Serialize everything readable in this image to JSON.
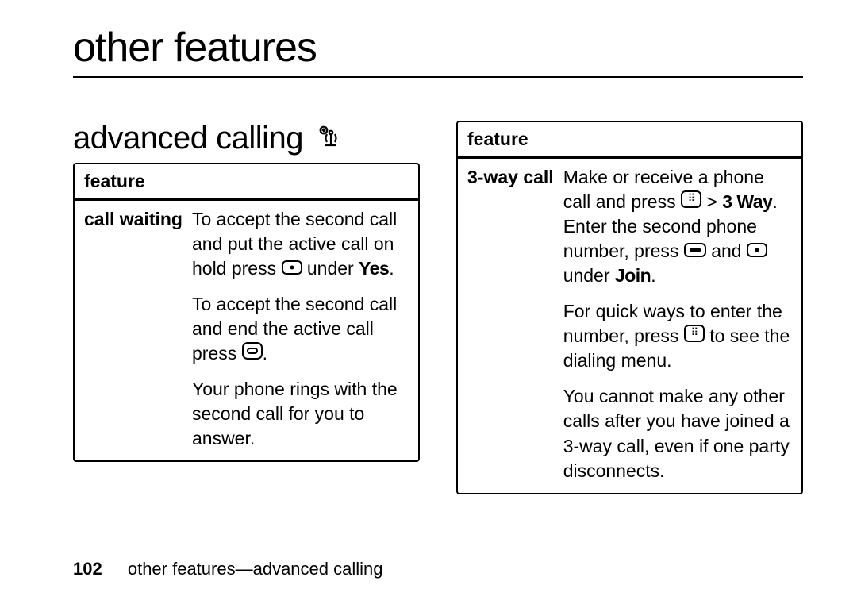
{
  "chapter": "other features",
  "section": "advanced calling",
  "tables": {
    "left": {
      "header": "feature",
      "feature_label": "call waiting",
      "p1_a": "To accept the second call and put the active call on hold press ",
      "p1_b": " under ",
      "p1_c": "Yes",
      "p1_d": ".",
      "p2_a": "To accept the second call and end the active call press ",
      "p2_b": ".",
      "p3": "Your phone rings with the second call for you to answer."
    },
    "right": {
      "header": "feature",
      "feature_label": "3-way call",
      "p1_a": "Make or receive a phone call and press ",
      "p1_b": " > ",
      "p1_c": "3 Way",
      "p1_d": ". Enter the second phone number, press ",
      "p1_e": " and ",
      "p1_f": " under ",
      "p1_g": "Join",
      "p1_h": ".",
      "p2_a": "For quick ways to enter the number, press ",
      "p2_b": " to see the dialing menu.",
      "p3": "You cannot make any other calls after you have joined a 3-way call, even if one party disconnects."
    }
  },
  "footer": {
    "page": "102",
    "text": "other features—advanced calling"
  }
}
